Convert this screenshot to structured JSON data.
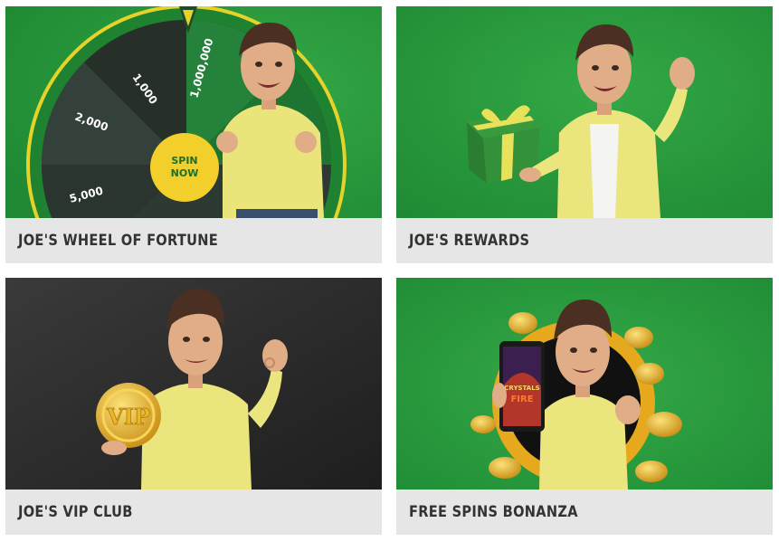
{
  "cards": [
    {
      "id": "wheel-of-fortune",
      "title": "JOE'S WHEEL OF FORTUNE",
      "background": "#2a9a3c",
      "wheel_labels": [
        "1,000",
        "1,000,000",
        "2,000",
        "5,000"
      ],
      "spin_button": {
        "line1": "SPIN",
        "line2": "NOW"
      }
    },
    {
      "id": "rewards",
      "title": "JOE'S REWARDS",
      "background": "#269a3a"
    },
    {
      "id": "vip-club",
      "title": "JOE'S VIP CLUB",
      "background": "#2c2c2c",
      "coin_text": "VIP"
    },
    {
      "id": "free-spins-bonanza",
      "title": "FREE SPINS BONANZA",
      "background": "#27a03a",
      "phone_game_title": {
        "line1": "CRYSTALS",
        "line2": "FIRE"
      }
    }
  ],
  "colors": {
    "caption_bg": "#e6e6e6",
    "caption_text": "#333333",
    "brand_green": "#2a9a3c",
    "shirt_yellow": "#e9e57a",
    "gold": "#e9b826"
  }
}
